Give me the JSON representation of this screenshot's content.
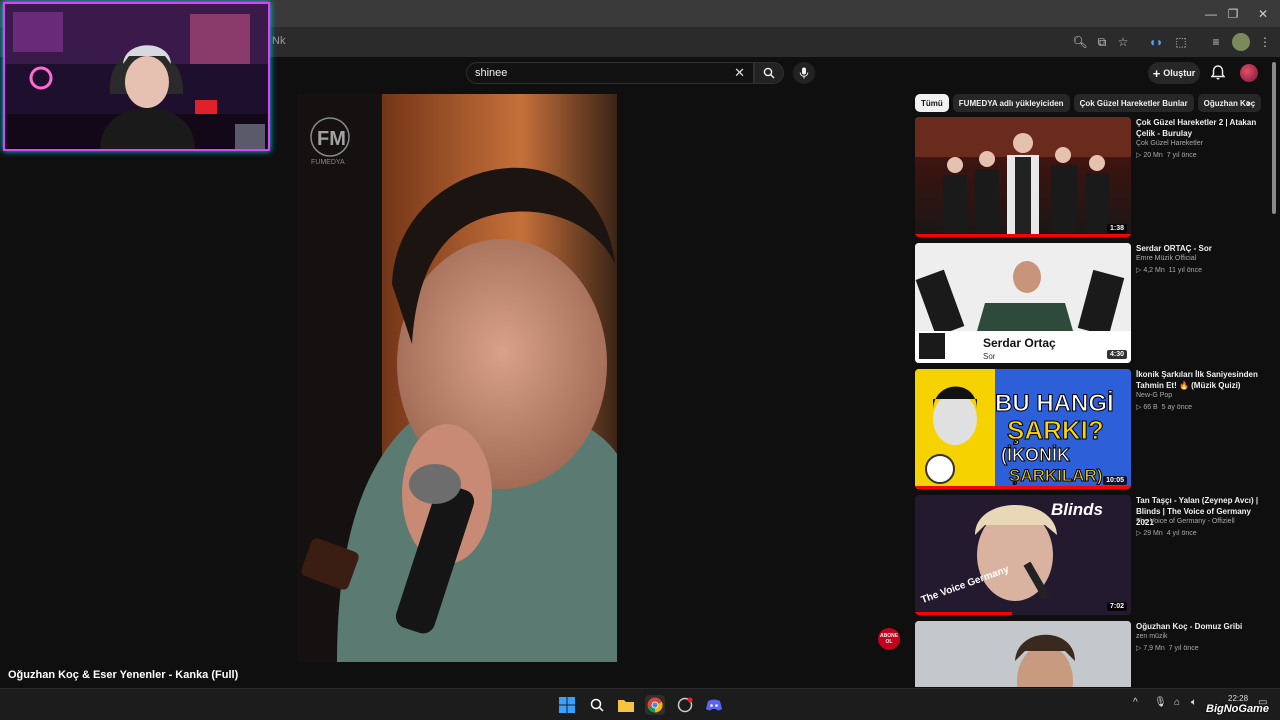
{
  "browser": {
    "url_fragment": "Nk",
    "window_controls": [
      "—",
      "❐",
      "✕"
    ]
  },
  "youtube": {
    "search": {
      "value": "shinee"
    },
    "create_label": "Oluştur",
    "video_title": "Oğuzhan Koç & Eser Yenenler - Kanka (Full)",
    "video_watermark": "FM",
    "video_watermark_sub": "FUMEDYA",
    "subscribe_badge": "ABONE OL",
    "chips": [
      "Tümü",
      "FUMEDYA adlı yükleyiciden",
      "Çok Güzel Hareketler Bunlar",
      "Oğuzhan Koç"
    ],
    "recommendations": [
      {
        "title": "Çok Güzel Hareketler 2 | Atakan Çelik - Burulay",
        "channel": "Çok Güzel Hareketler",
        "views": "20 Mn",
        "age": "7 yıl önce",
        "duration": "1:38",
        "progress": 1.0
      },
      {
        "title": "Serdar ORTAÇ - Sor",
        "channel": "Emre Müzik Official",
        "views": "4,2 Mn",
        "age": "11 yıl önce",
        "duration": "4:30",
        "overlay_name": "Serdar Ortaç",
        "overlay_song": "Sor",
        "progress": 0
      },
      {
        "title": "İkonik Şarkıları İlk Saniyesinden Tahmin Et! 🔥 (Müzik Quizi)",
        "channel": "New-G Pop",
        "views": "66 B",
        "age": "5 ay önce",
        "duration": "10:05",
        "thumb_line1": "BU HANGİ",
        "thumb_line2": "ŞARKI?",
        "thumb_line3": "(İKONİK",
        "thumb_line4": "ŞARKILAR)",
        "progress": 1.0
      },
      {
        "title": "Tan Taşçı - Yalan (Zeynep Avcı) | Blinds | The Voice of Germany 2021",
        "channel": "The Voice of Germany - Offiziell",
        "views": "29 Mn",
        "age": "4 yıl önce",
        "duration": "7:02",
        "thumb_badge": "Blinds",
        "thumb_logo": "The Voice Germany",
        "progress": 0.45
      },
      {
        "title": "Oğuzhan Koç - Domuz Gribi",
        "channel": "zen müzik",
        "views": "7,9 Mn",
        "age": "7 yıl önce",
        "duration": "",
        "progress": 0
      }
    ]
  },
  "taskbar": {
    "time": "22:28",
    "watermark": "BigNoGame"
  },
  "colors": {
    "accent_red": "#ff0000",
    "neon_pink": "#e040fb",
    "neon_cyan": "#00d5ff"
  }
}
